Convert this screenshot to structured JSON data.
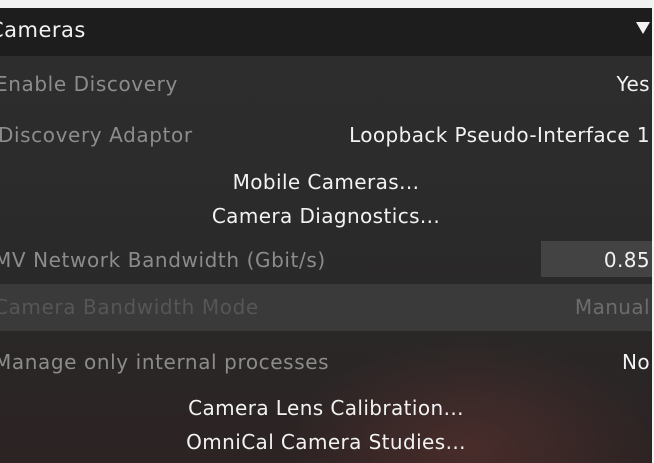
{
  "panel": {
    "title": "Cameras",
    "collapse_icon": "triangle-down-icon"
  },
  "settings": {
    "enable_discovery": {
      "label": "Enable Discovery",
      "value": "Yes"
    },
    "discovery_adaptor": {
      "label": "Discovery Adaptor",
      "value": "Loopback Pseudo-Interface 1"
    },
    "mobile_cameras_button": "Mobile Cameras...",
    "camera_diagnostics_button": "Camera Diagnostics...",
    "mv_network_bandwidth": {
      "label": "MV Network Bandwidth (Gbit/s)",
      "value": "0.85"
    },
    "camera_bandwidth_mode": {
      "label": "Camera Bandwidth Mode",
      "value": "Manual"
    },
    "manage_internal_processes": {
      "label": "Manage only internal processes",
      "value": "No"
    },
    "camera_lens_calibration_button": "Camera Lens Calibration...",
    "omnical_camera_studies_button": "OmniCal Camera Studies..."
  },
  "colors": {
    "panel_background": "#2b2b2b",
    "header_background": "#1d1d1d",
    "label_text": "#8c8c8c",
    "value_text": "#f2f2f2",
    "disabled_row": "#3a3a3a",
    "input_field": "#434343"
  }
}
